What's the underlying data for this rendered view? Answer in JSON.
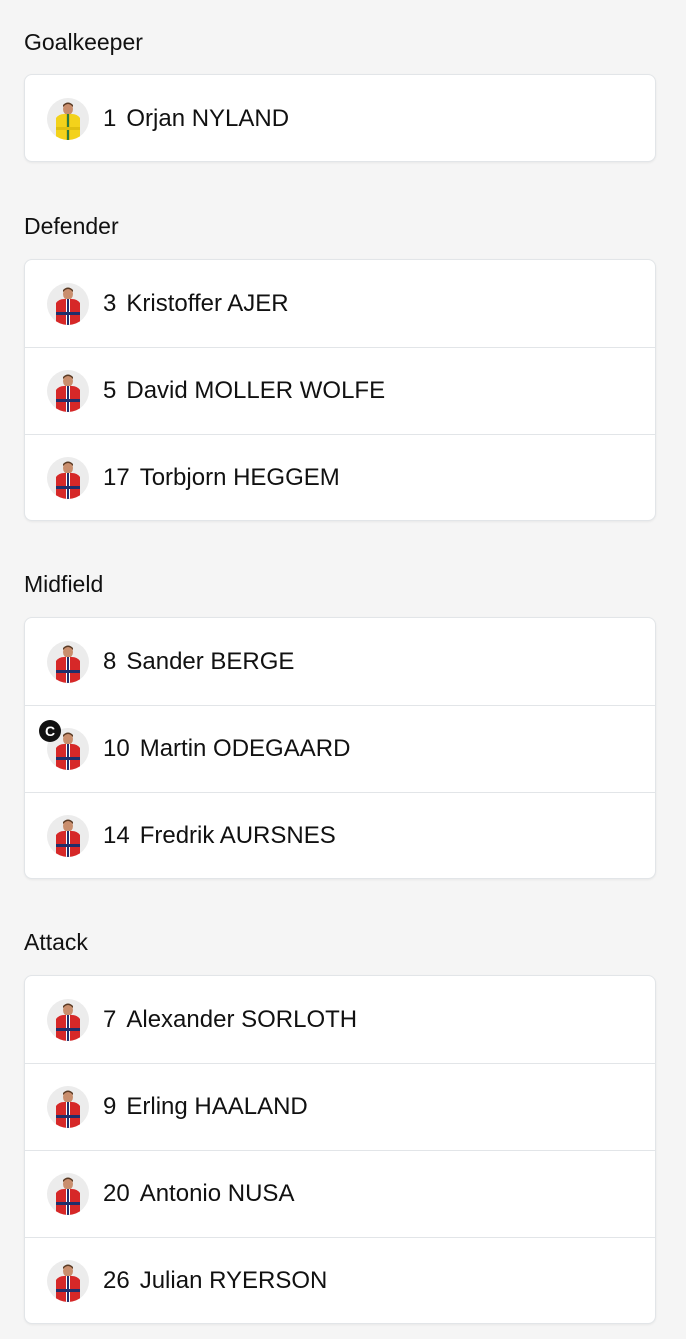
{
  "colors": {
    "background": "#f5f5f5",
    "card": "#ffffff",
    "border": "#e2e5e8",
    "kit_red": "#d62828",
    "kit_navy": "#1f2f6b",
    "keeper_yellow": "#f3d21b"
  },
  "sections": [
    {
      "title": "Goalkeeper",
      "players": [
        {
          "number": "1",
          "name": "Orjan NYLAND",
          "kit": "keeper",
          "captain": false
        }
      ]
    },
    {
      "title": "Defender",
      "players": [
        {
          "number": "3",
          "name": "Kristoffer AJER",
          "kit": "outfield",
          "captain": false
        },
        {
          "number": "5",
          "name": "David MOLLER WOLFE",
          "kit": "outfield",
          "captain": false
        },
        {
          "number": "17",
          "name": "Torbjorn HEGGEM",
          "kit": "outfield",
          "captain": false
        }
      ]
    },
    {
      "title": "Midfield",
      "players": [
        {
          "number": "8",
          "name": "Sander BERGE",
          "kit": "outfield",
          "captain": false
        },
        {
          "number": "10",
          "name": "Martin ODEGAARD",
          "kit": "outfield",
          "captain": true
        },
        {
          "number": "14",
          "name": "Fredrik AURSNES",
          "kit": "outfield",
          "captain": false
        }
      ]
    },
    {
      "title": "Attack",
      "players": [
        {
          "number": "7",
          "name": "Alexander SORLOTH",
          "kit": "outfield",
          "captain": false
        },
        {
          "number": "9",
          "name": "Erling HAALAND",
          "kit": "outfield",
          "captain": false
        },
        {
          "number": "20",
          "name": "Antonio NUSA",
          "kit": "outfield",
          "captain": false
        },
        {
          "number": "26",
          "name": "Julian RYERSON",
          "kit": "outfield",
          "captain": false
        }
      ]
    }
  ],
  "captain_badge_label": "C"
}
